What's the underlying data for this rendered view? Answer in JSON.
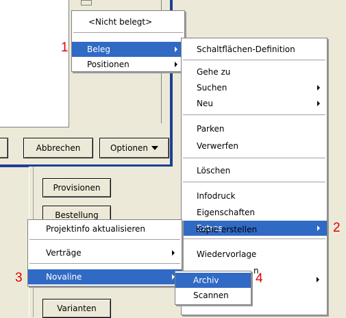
{
  "background": {
    "buttons": {
      "cancel": "Abbrechen",
      "options": "Optionen",
      "provisions": "Provisionen",
      "order": "Bestellung",
      "variants": "Varianten"
    },
    "obscured_text": {
      "wiedervorlage_fragment": "Kopie erstellen",
      "second_fragment": "n",
      "belege_fragment": "ege"
    }
  },
  "menu_top": {
    "items": [
      {
        "label": "<Nicht belegt>"
      },
      {
        "label": "Beleg",
        "submenu": true,
        "selected": true
      },
      {
        "label": "Positionen",
        "submenu": true
      }
    ]
  },
  "menu_beleg": {
    "items": [
      {
        "label": "Schaltflächen-Definition"
      },
      {
        "label": "Gehe zu"
      },
      {
        "label": "Suchen",
        "submenu": true
      },
      {
        "label": "Neu",
        "submenu": true
      },
      {
        "label": "Parken"
      },
      {
        "label": "Verwerfen"
      },
      {
        "label": "Löschen"
      },
      {
        "label": "Infodruck"
      },
      {
        "label": "Eigenschaften"
      },
      {
        "label": "Extras",
        "submenu": true,
        "selected": true
      },
      {
        "label": "Wiedervorlage"
      }
    ]
  },
  "menu_extras": {
    "items": [
      {
        "label": "Projektinfo aktualisieren"
      },
      {
        "label": "Verträge",
        "submenu": true
      },
      {
        "label": "Novaline",
        "submenu": true,
        "selected": true
      }
    ]
  },
  "menu_novaline": {
    "items": [
      {
        "label": "Archiv",
        "selected": true
      },
      {
        "label": "Scannen"
      }
    ]
  },
  "annotations": {
    "n1": "1",
    "n2": "2",
    "n3": "3",
    "n4": "4"
  },
  "colors": {
    "selection": "#316ac5",
    "annotation": "#e00000",
    "frame_blue": "#1c3f94"
  }
}
